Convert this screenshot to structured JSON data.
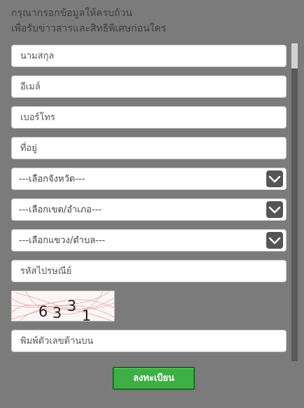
{
  "heading": {
    "line1": "กรุณากรอกข้อมูลให้ครบถ้วน",
    "line2": "เพื่อรับข่าวสารและสิทธิพิเศษก่อนใคร"
  },
  "form": {
    "fullname_placeholder": "นามสกุล",
    "email_placeholder": "อีเมล์",
    "phone_placeholder": "เบอร์โทร",
    "address_placeholder": "ที่อยู่",
    "province_selected": "---เลือกจังหวัด---",
    "district_selected": "---เลือกเขต/อำเภอ---",
    "subdistrict_selected": "---เลือกแขวง/ตำบล---",
    "postcode_placeholder": "รหัสไปรษณีย์",
    "captcha_digits": [
      "6",
      "3",
      "3",
      "1"
    ],
    "captcha_input_placeholder": "พิมพ์ตัวเลขด้านบน",
    "submit_label": "ลงทะเบียน"
  },
  "colors": {
    "background": "#7b7b7b",
    "submit": "#3cb044",
    "dropdown_button": "#555555"
  }
}
